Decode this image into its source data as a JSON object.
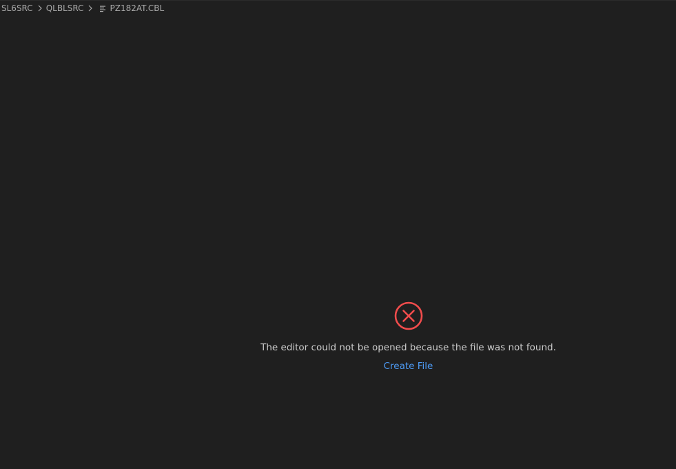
{
  "breadcrumb": {
    "items": [
      "SL6SRC",
      "QLBLSRC",
      "PZ182AT.CBL"
    ],
    "file_icon": "file-lines-icon",
    "separator_icon": "chevron-right-icon"
  },
  "error": {
    "icon": "error-circle-x-icon",
    "message": "The editor could not be opened because the file was not found.",
    "action_label": "Create File"
  },
  "colors": {
    "background": "#1f1f1f",
    "error_red": "#f14c4c",
    "link_blue": "#4d9bf5",
    "text": "#cccccc"
  }
}
